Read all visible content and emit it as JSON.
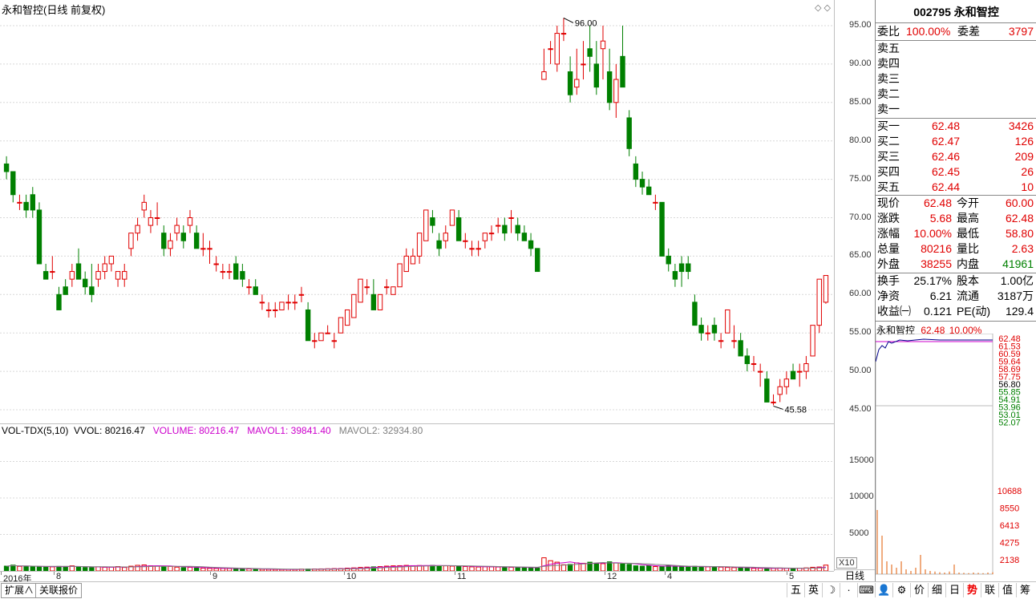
{
  "chart_title": "永和智控(日线 前复权)",
  "price_axis": [
    "95.00",
    "90.00",
    "85.00",
    "80.00",
    "75.00",
    "70.00",
    "65.00",
    "60.00",
    "55.00",
    "50.00",
    "45.00"
  ],
  "vol_axis": [
    "15000",
    "10000",
    "5000"
  ],
  "vol_axis_unit": "X10",
  "x_axis": [
    "2016年",
    "8",
    "9",
    "10",
    "11",
    "12",
    "4",
    "5"
  ],
  "high_label": "96.00",
  "low_label": "45.58",
  "vol_legend": {
    "name": "VOL-TDX(5,10)",
    "vvol": "VVOL: 80216.47",
    "volume": "VOLUME: 80216.47",
    "mavol1": "MAVOL1: 39841.40",
    "mavol2": "MAVOL2: 32934.80"
  },
  "colors": {
    "up": "#e00000",
    "down": "#008000",
    "ma1": "#cc00cc",
    "ma2": "#808080"
  },
  "quote": {
    "code_name": "002795 永和智控",
    "weibi_label": "委比",
    "weibi": "100.00%",
    "weicha_label": "委差",
    "weicha": "3797",
    "sells": [
      "卖五",
      "卖四",
      "卖三",
      "卖二",
      "卖一"
    ],
    "buys": [
      {
        "label": "买一",
        "price": "62.48",
        "vol": "3426"
      },
      {
        "label": "买二",
        "price": "62.47",
        "vol": "126"
      },
      {
        "label": "买三",
        "price": "62.46",
        "vol": "209"
      },
      {
        "label": "买四",
        "price": "62.45",
        "vol": "26"
      },
      {
        "label": "买五",
        "price": "62.44",
        "vol": "10"
      }
    ],
    "stats": [
      {
        "l1": "现价",
        "v1": "62.48",
        "c1": "red",
        "l2": "今开",
        "v2": "60.00",
        "c2": "red"
      },
      {
        "l1": "涨跌",
        "v1": "5.68",
        "c1": "red",
        "l2": "最高",
        "v2": "62.48",
        "c2": "red"
      },
      {
        "l1": "涨幅",
        "v1": "10.00%",
        "c1": "red",
        "l2": "最低",
        "v2": "58.80",
        "c2": "red"
      },
      {
        "l1": "总量",
        "v1": "80216",
        "c1": "red",
        "l2": "量比",
        "v2": "2.63",
        "c2": "red"
      },
      {
        "l1": "外盘",
        "v1": "38255",
        "c1": "red",
        "l2": "内盘",
        "v2": "41961",
        "c2": "green"
      }
    ],
    "finance": [
      {
        "l1": "换手",
        "v1": "25.17%",
        "l2": "股本",
        "v2": "1.00亿"
      },
      {
        "l1": "净资",
        "v1": "6.21",
        "l2": "流通",
        "v2": "3187万"
      },
      {
        "l1": "收益㈠",
        "v1": "0.121",
        "l2": "PE(动)",
        "v2": "129.4"
      }
    ]
  },
  "mini": {
    "name": "永和智控",
    "price": "62.48",
    "pct": "10.00%",
    "price_axis": [
      "62.48",
      "61.53",
      "60.59",
      "59.64",
      "58.69",
      "57.75",
      "56.80",
      "55.85",
      "54.91",
      "53.96",
      "53.01",
      "52.07"
    ],
    "vol_axis": [
      "10688",
      "8550",
      "6413",
      "4275",
      "2138"
    ]
  },
  "bottom": {
    "tab1": "扩展∧",
    "tab2": "关联报价",
    "daily": "日线",
    "buttons": [
      "五",
      "英",
      "☽",
      "·",
      "⌨",
      "👤",
      "⚙",
      "价",
      "细",
      "日",
      "势",
      "联",
      "值",
      "筹"
    ]
  },
  "candles": [
    [
      77,
      78,
      75,
      76
    ],
    [
      76,
      76,
      72,
      73
    ],
    [
      72,
      73,
      71,
      72
    ],
    [
      72,
      73,
      70,
      71
    ],
    [
      73,
      74,
      70,
      71
    ],
    [
      71,
      72,
      64,
      64
    ],
    [
      63,
      64,
      62,
      62
    ],
    [
      63,
      65,
      62,
      63
    ],
    [
      60,
      61,
      59,
      58
    ],
    [
      61,
      62,
      60,
      60
    ],
    [
      62,
      64,
      61,
      63
    ],
    [
      64,
      66,
      62,
      62
    ],
    [
      62,
      63,
      60,
      61
    ],
    [
      61,
      64,
      59,
      60
    ],
    [
      62,
      64,
      61,
      63
    ],
    [
      63,
      65,
      62,
      64
    ],
    [
      64,
      65,
      63,
      65
    ],
    [
      62,
      63,
      61,
      63
    ],
    [
      62,
      64,
      61,
      63
    ],
    [
      66,
      68,
      65,
      68
    ],
    [
      68,
      70,
      67,
      69
    ],
    [
      71,
      73,
      70,
      72
    ],
    [
      69,
      71,
      68,
      70
    ],
    [
      70,
      72,
      69,
      70
    ],
    [
      68,
      69,
      65,
      66
    ],
    [
      66,
      68,
      65,
      67
    ],
    [
      68,
      70,
      67,
      69
    ],
    [
      68,
      69,
      66,
      67
    ],
    [
      69,
      71,
      68,
      70
    ],
    [
      68,
      69,
      66,
      66
    ],
    [
      66,
      68,
      65,
      66
    ],
    [
      66,
      67,
      64,
      66
    ],
    [
      64,
      65,
      63,
      64
    ],
    [
      63,
      64,
      62,
      63
    ],
    [
      63,
      64,
      62,
      63
    ],
    [
      64,
      65,
      62,
      62
    ],
    [
      63,
      64,
      61,
      62
    ],
    [
      61,
      62,
      60,
      61
    ],
    [
      61,
      62,
      60,
      60
    ],
    [
      59,
      60,
      58,
      59
    ],
    [
      58,
      59,
      57,
      58
    ],
    [
      58,
      59,
      57,
      58
    ],
    [
      58,
      59,
      58,
      59
    ],
    [
      59,
      60,
      58,
      59
    ],
    [
      59,
      60,
      58,
      59
    ],
    [
      60,
      61,
      59,
      60
    ],
    [
      58,
      59,
      54,
      54
    ],
    [
      54,
      55,
      53,
      54
    ],
    [
      54,
      55,
      54,
      55
    ],
    [
      55,
      56,
      55,
      55
    ],
    [
      54,
      55,
      53,
      54
    ],
    [
      55,
      57,
      55,
      57
    ],
    [
      56,
      58,
      56,
      58
    ],
    [
      57,
      60,
      57,
      60
    ],
    [
      59,
      62,
      59,
      62
    ],
    [
      61,
      62,
      60,
      61
    ],
    [
      60,
      62,
      58,
      58
    ],
    [
      58,
      60,
      58,
      60
    ],
    [
      61,
      62,
      60,
      61
    ],
    [
      60,
      61,
      60,
      61
    ],
    [
      61,
      64,
      61,
      64
    ],
    [
      63,
      66,
      63,
      65
    ],
    [
      64,
      66,
      64,
      65
    ],
    [
      65,
      68,
      64,
      68
    ],
    [
      67,
      71,
      67,
      71
    ],
    [
      70,
      71,
      68,
      69
    ],
    [
      67,
      68,
      65,
      66
    ],
    [
      67,
      69,
      66,
      68
    ],
    [
      69,
      71,
      69,
      71
    ],
    [
      70,
      71,
      67,
      67
    ],
    [
      67,
      68,
      66,
      67
    ],
    [
      66,
      67,
      65,
      66
    ],
    [
      66,
      67,
      65,
      66
    ],
    [
      67,
      68,
      66,
      68
    ],
    [
      68,
      69,
      67,
      68
    ],
    [
      69,
      70,
      68,
      69
    ],
    [
      69,
      70,
      67,
      68
    ],
    [
      70,
      71,
      68,
      70
    ],
    [
      69,
      70,
      67,
      68
    ],
    [
      68,
      69,
      67,
      67
    ],
    [
      67,
      68,
      65,
      66
    ],
    [
      66,
      66,
      63,
      63
    ],
    [
      88,
      92,
      88,
      89
    ],
    [
      92,
      93,
      90,
      92
    ],
    [
      90,
      95,
      89,
      94
    ],
    [
      94,
      96,
      93,
      94
    ],
    [
      89,
      91,
      85,
      86
    ],
    [
      87,
      92,
      86,
      88
    ],
    [
      90,
      93,
      88,
      90
    ],
    [
      92,
      95,
      89,
      91
    ],
    [
      90,
      93,
      86,
      87
    ],
    [
      92,
      95,
      88,
      93
    ],
    [
      89,
      92,
      84,
      85
    ],
    [
      85,
      90,
      83,
      88
    ],
    [
      91,
      95,
      88,
      87
    ],
    [
      83,
      84,
      78,
      79
    ],
    [
      77,
      78,
      74,
      75
    ],
    [
      75,
      76,
      73,
      74
    ],
    [
      74,
      75,
      73,
      73
    ],
    [
      72,
      73,
      71,
      72
    ],
    [
      72,
      72,
      65,
      65
    ],
    [
      65,
      66,
      63,
      64
    ],
    [
      63,
      64,
      61,
      62
    ],
    [
      64,
      65,
      61,
      63
    ],
    [
      64,
      65,
      62,
      63
    ],
    [
      59,
      60,
      56,
      56
    ],
    [
      56,
      57,
      54,
      55
    ],
    [
      55,
      56,
      54,
      55
    ],
    [
      56,
      57,
      54,
      55
    ],
    [
      54,
      55,
      53,
      54
    ],
    [
      55,
      58,
      55,
      58
    ],
    [
      54,
      56,
      53,
      54
    ],
    [
      54,
      55,
      52,
      52
    ],
    [
      52,
      53,
      50,
      51
    ],
    [
      51,
      52,
      50,
      51
    ],
    [
      50,
      51,
      48,
      50
    ],
    [
      49,
      50,
      46,
      46
    ],
    [
      46,
      47,
      45.58,
      46
    ],
    [
      47,
      49,
      46,
      48
    ],
    [
      48,
      50,
      47,
      49
    ],
    [
      50,
      51,
      49,
      49
    ],
    [
      50,
      51,
      48,
      50
    ],
    [
      50,
      52,
      49,
      51
    ],
    [
      52,
      55,
      52,
      56
    ],
    [
      56,
      62,
      55,
      62
    ],
    [
      59,
      62.48,
      58.8,
      62.48
    ]
  ],
  "volumes": [
    660,
    800,
    630,
    620,
    580,
    580,
    600,
    560,
    620,
    610,
    700,
    560,
    480,
    470,
    560,
    500,
    520,
    600,
    480,
    650,
    770,
    820,
    700,
    650,
    600,
    620,
    520,
    460,
    500,
    420,
    380,
    360,
    340,
    340,
    330,
    320,
    300,
    280,
    250,
    230,
    220,
    210,
    200,
    210,
    200,
    250,
    260,
    270,
    280,
    300,
    320,
    330,
    380,
    420,
    480,
    520,
    560,
    600,
    660,
    700,
    720,
    760,
    720,
    740,
    720,
    760,
    720,
    700,
    660,
    620,
    600,
    560,
    540,
    580,
    560,
    540,
    520,
    500,
    480,
    460,
    420,
    400,
    1800,
    1400,
    1200,
    850,
    900,
    1100,
    1050,
    1200,
    1050,
    1000,
    1250,
    1100,
    950,
    900,
    700,
    650,
    720,
    600,
    650,
    720,
    580,
    560,
    560,
    640,
    600,
    560,
    560,
    520,
    480,
    460,
    420,
    400,
    360,
    360,
    340,
    360,
    400,
    360,
    340,
    380,
    420,
    500,
    540,
    800
  ]
}
